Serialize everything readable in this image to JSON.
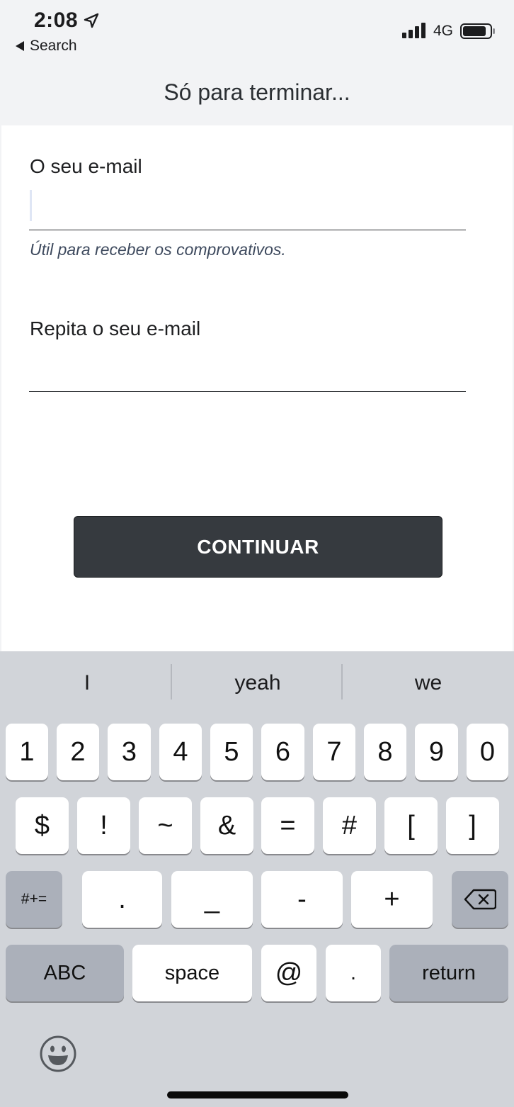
{
  "status_bar": {
    "time": "2:08",
    "back_label": "Search",
    "network": "4G"
  },
  "nav": {
    "title": "Só para terminar..."
  },
  "form": {
    "email_label": "O seu e-mail",
    "email_value": "",
    "email_hint": "Útil para receber os comprovativos.",
    "repeat_label": "Repita o seu e-mail",
    "repeat_value": "",
    "continue_label": "CONTINUAR"
  },
  "keyboard": {
    "suggestions": [
      "I",
      "yeah",
      "we"
    ],
    "row1": [
      "1",
      "2",
      "3",
      "4",
      "5",
      "6",
      "7",
      "8",
      "9",
      "0"
    ],
    "row2": [
      "$",
      "!",
      "~",
      "&",
      "=",
      "#",
      "[",
      "]"
    ],
    "row3": {
      "mode": "#+=",
      "keys": [
        ".",
        "_",
        "-",
        "+"
      ]
    },
    "row4": {
      "abc": "ABC",
      "space": "space",
      "at": "@",
      "dot": ".",
      "return": "return"
    },
    "icons": [
      "delete-icon",
      "emoji-icon"
    ]
  }
}
